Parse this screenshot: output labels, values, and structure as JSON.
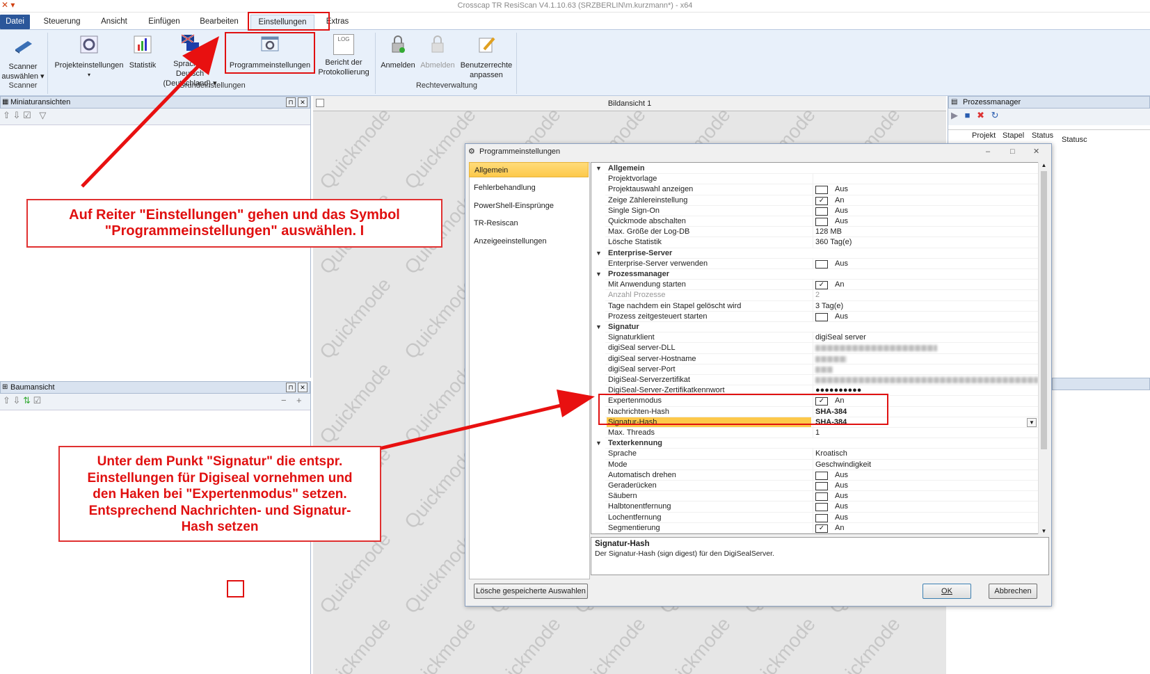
{
  "app": {
    "title": "Crosscap TR ResiScan V4.1.10.63 (SRZBERLIN\\m.kurzmann*) - x64"
  },
  "tabs": [
    "Datei",
    "Steuerung",
    "Ansicht",
    "Einfügen",
    "Bearbeiten",
    "Einstellungen",
    "Extras"
  ],
  "ribbon": {
    "scanner": {
      "label1": "Scanner",
      "label2": "auswählen",
      "group": "Scanner"
    },
    "projekt": "Projekteinstellungen",
    "statistik": "Statistik",
    "sprache1": "Sprache - Deutsch",
    "sprache2": "(Deutschland)",
    "programm": "Programmeinstellungen",
    "bericht1": "Bericht der",
    "bericht2": "Protokollierung",
    "group_grund": "Grundeinstellungen",
    "anmelden": "Anmelden",
    "abmelden": "Abmelden",
    "benutzer1": "Benutzerrechte",
    "benutzer2": "anpassen",
    "group_rechte": "Rechteverwaltung",
    "log_icon": "LOG"
  },
  "panels": {
    "miniatur": "Miniaturansichten",
    "baum": "Baumansicht",
    "bild": "Bildansicht 1",
    "prozess": "Prozessmanager",
    "prozess_cols": [
      "Projekt",
      "Stapel",
      "Status",
      "Statusc"
    ]
  },
  "watermark": "Quickmode",
  "dialog": {
    "title": "Programmeinstellungen",
    "categories": [
      "Allgemein",
      "Fehlerbehandlung",
      "PowerShell-Einsprünge",
      "TR-Resiscan",
      "Anzeigeeinstellungen"
    ],
    "rows": [
      {
        "name": "Allgemein",
        "group": true
      },
      {
        "name": "Projektvorlage",
        "value": ""
      },
      {
        "name": "Projektauswahl anzeigen",
        "cb": false,
        "value": "Aus"
      },
      {
        "name": "Zeige Zählereinstellung",
        "cb": true,
        "value": "An"
      },
      {
        "name": "Single Sign-On",
        "cb": false,
        "value": "Aus"
      },
      {
        "name": "Quickmode abschalten",
        "cb": false,
        "value": "Aus"
      },
      {
        "name": "Max. Größe der Log-DB",
        "value": "128 MB"
      },
      {
        "name": "Lösche Statistik",
        "value": "360 Tag(e)"
      },
      {
        "name": "Enterprise-Server",
        "group": true
      },
      {
        "name": "Enterprise-Server verwenden",
        "cb": false,
        "value": "Aus"
      },
      {
        "name": "Prozessmanager",
        "group": true
      },
      {
        "name": "Mit Anwendung starten",
        "cb": true,
        "value": "An"
      },
      {
        "name": "Anzahl Prozesse",
        "value": "2",
        "gray": true
      },
      {
        "name": "Tage nachdem ein Stapel gelöscht wird",
        "value": "3 Tag(e)"
      },
      {
        "name": "Prozess zeitgesteuert starten",
        "cb": false,
        "value": "Aus"
      },
      {
        "name": "Signatur",
        "group": true
      },
      {
        "name": "Signaturklient",
        "value": "digiSeal server"
      },
      {
        "name": "digiSeal server-DLL",
        "blur": 175
      },
      {
        "name": "digiSeal server-Hostname",
        "blur": 45
      },
      {
        "name": "digiSeal server-Port",
        "blur": 25
      },
      {
        "name": "DigiSeal-Serverzertifikat",
        "blur": 320
      },
      {
        "name": "DigiSeal-Server-Zertifikatkennwort",
        "value": "●●●●●●●●●●"
      },
      {
        "name": "Expertenmodus",
        "cb": true,
        "value": "An"
      },
      {
        "name": "Nachrichten-Hash",
        "value": "SHA-384",
        "bold": true
      },
      {
        "name": "Signatur-Hash",
        "value": "SHA-384",
        "bold": true,
        "selected": true
      },
      {
        "name": "Max. Threads",
        "value": "1"
      },
      {
        "name": "Texterkennung",
        "group": true
      },
      {
        "name": "Sprache",
        "value": "Kroatisch"
      },
      {
        "name": "Mode",
        "value": "Geschwindigkeit"
      },
      {
        "name": "Automatisch drehen",
        "cb": false,
        "value": "Aus"
      },
      {
        "name": "Geraderücken",
        "cb": false,
        "value": "Aus"
      },
      {
        "name": "Säubern",
        "cb": false,
        "value": "Aus"
      },
      {
        "name": "Halbtonentfernung",
        "cb": false,
        "value": "Aus"
      },
      {
        "name": "Lochentfernung",
        "cb": false,
        "value": "Aus"
      },
      {
        "name": "Segmentierung",
        "cb": true,
        "value": "An"
      }
    ],
    "desc_title": "Signatur-Hash",
    "desc_text": "Der Signatur-Hash (sign digest) für den DigiSealServer.",
    "btn_clear": "Lösche gespeicherte Auswahlen",
    "btn_ok": "OK",
    "btn_cancel": "Abbrechen"
  },
  "notes": {
    "top1": "Auf Reiter \"Einstellungen\" gehen und das Symbol",
    "top2": "\"Programmeinstellungen\" auswählen. I",
    "bottom": [
      "Unter dem Punkt \"Signatur\" die entspr.",
      "Einstellungen für Digiseal vornehmen und",
      "den Haken bei \"Expertenmodus\" setzen.",
      "Entsprechend Nachrichten- und Signatur-",
      "Hash setzen"
    ]
  },
  "colors": {
    "annotation": "#e01010",
    "ribbon_bg": "#e8f0fa",
    "datei_tab": "#2b579a",
    "selection": "#fdc94a"
  }
}
